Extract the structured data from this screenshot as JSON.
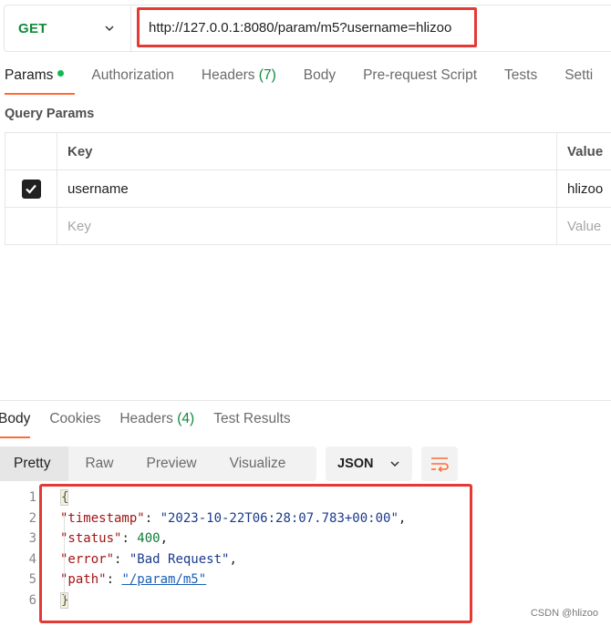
{
  "request": {
    "method": "GET",
    "url": "http://127.0.0.1:8080/param/m5?username=hlizoo"
  },
  "request_tabs": [
    {
      "label": "Params",
      "active": true,
      "dot": true
    },
    {
      "label": "Authorization"
    },
    {
      "label": "Headers",
      "count": "(7)"
    },
    {
      "label": "Body"
    },
    {
      "label": "Pre-request Script"
    },
    {
      "label": "Tests"
    },
    {
      "label": "Setti"
    }
  ],
  "query_params": {
    "title": "Query Params",
    "headers": {
      "key": "Key",
      "value": "Value"
    },
    "rows": [
      {
        "checked": true,
        "key": "username",
        "value": "hlizoo"
      }
    ],
    "placeholder": {
      "key": "Key",
      "value": "Value"
    }
  },
  "response_tabs": [
    {
      "label": "Body",
      "active": true
    },
    {
      "label": "Cookies"
    },
    {
      "label": "Headers",
      "count": "(4)"
    },
    {
      "label": "Test Results"
    }
  ],
  "view_modes": [
    "Pretty",
    "Raw",
    "Preview",
    "Visualize"
  ],
  "active_view": "Pretty",
  "format": "JSON",
  "response_body": {
    "line_numbers": [
      "1",
      "2",
      "3",
      "4",
      "5",
      "6"
    ],
    "open_brace": "{",
    "close_brace": "}",
    "fields": [
      {
        "key": "\"timestamp\"",
        "value": "\"2023-10-22T06:28:07.783+00:00\"",
        "type": "string",
        "trail": ","
      },
      {
        "key": "\"status\"",
        "value": "400",
        "type": "number",
        "trail": ","
      },
      {
        "key": "\"error\"",
        "value": "\"Bad Request\"",
        "type": "string",
        "trail": ","
      },
      {
        "key": "\"path\"",
        "value": "\"/param/m5\"",
        "type": "link",
        "trail": ""
      }
    ]
  },
  "watermark": "CSDN @hlizoo",
  "colors": {
    "accent": "#ff6c37",
    "method_get": "#0f8a3a",
    "highlight_box": "#e53935"
  }
}
